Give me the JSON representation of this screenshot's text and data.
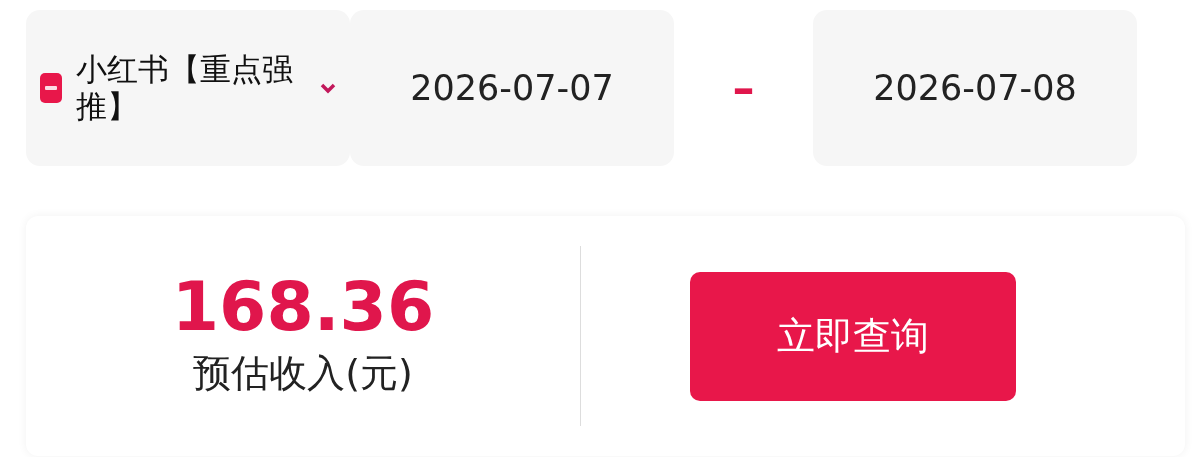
{
  "platform_select": {
    "value": "小红书【重点强推】"
  },
  "date_range": {
    "start": "2026-07-07",
    "separator": "–",
    "end": "2026-07-08"
  },
  "summary": {
    "amount": "168.36",
    "label": "预估收入(元)",
    "button": "立即查询"
  }
}
